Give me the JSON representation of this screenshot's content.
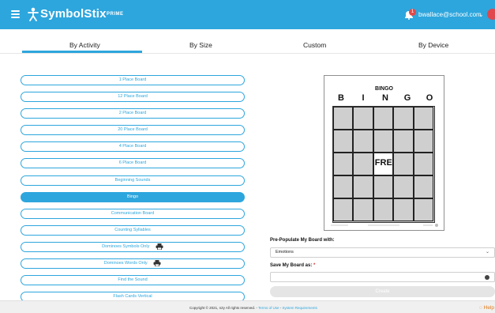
{
  "app": {
    "brand": "SymbolStix",
    "brand_tier": "PRIME"
  },
  "user": {
    "email": "bwallace@school.com",
    "notification_count": "1"
  },
  "tabs": [
    {
      "label": "By Activity",
      "active": true
    },
    {
      "label": "By Size",
      "active": false
    },
    {
      "label": "Custom",
      "active": false
    },
    {
      "label": "By Device",
      "active": false
    }
  ],
  "activities": [
    {
      "label": "1 Place Board"
    },
    {
      "label": "12 Place Board"
    },
    {
      "label": "2 Place Board"
    },
    {
      "label": "20 Place Board"
    },
    {
      "label": "4 Place Board"
    },
    {
      "label": "6 Place Board"
    },
    {
      "label": "Beginning Sounds"
    },
    {
      "label": "Bingo",
      "selected": true
    },
    {
      "label": "Communication Board"
    },
    {
      "label": "Counting Syllables"
    },
    {
      "label": "Dominoes Symbols Only",
      "printer": true
    },
    {
      "label": "Dominoes Words Only",
      "printer": true
    },
    {
      "label": "Find the Sound"
    },
    {
      "label": "Flash Cards Vertical"
    }
  ],
  "preview": {
    "title": "BINGO",
    "letters": [
      "B",
      "I",
      "N",
      "G",
      "O"
    ],
    "free_label": "FREE!"
  },
  "form": {
    "prepopulate_label": "Pre-Populate My Board with:",
    "prepopulate_value": "Emotions",
    "save_label": "Save My Board as:",
    "required_mark": "*",
    "save_value": "",
    "create_label": "Create"
  },
  "footer": {
    "copyright": "Copyright © 2021, n2y All rights reserved. - ",
    "terms": "Terms of Use",
    "separator": " - ",
    "system_requirements": "System Requirements",
    "help": "Help"
  },
  "colors": {
    "accent": "#2da6dd",
    "alert": "#e0484e",
    "help": "#e07a1c"
  }
}
